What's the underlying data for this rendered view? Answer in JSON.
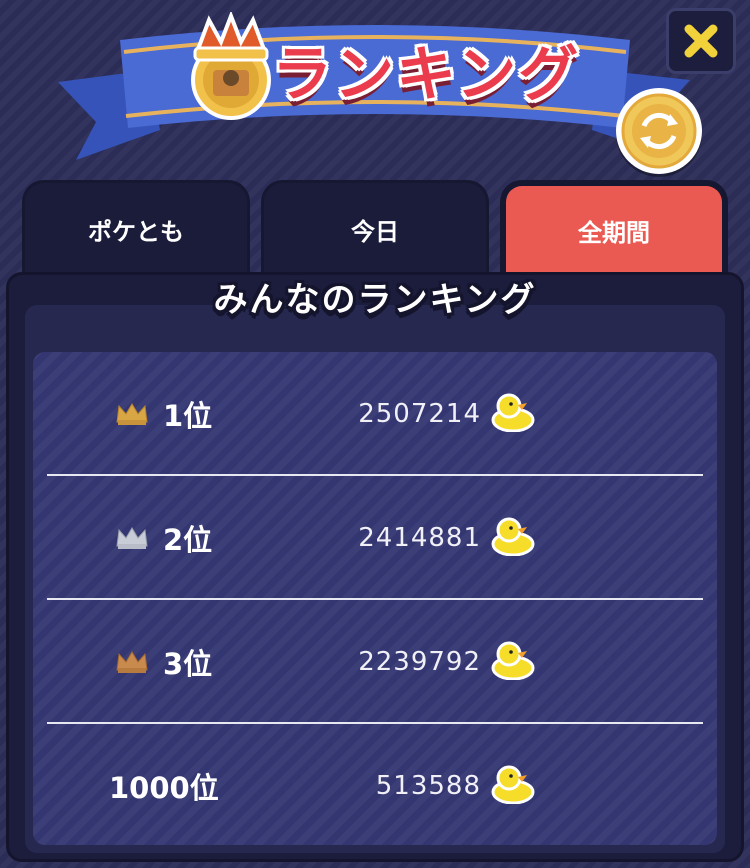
{
  "header": {
    "title": "ランキング",
    "close_icon": "close-x-icon",
    "refresh_icon": "refresh-coin-icon"
  },
  "tabs": [
    {
      "label": "ポケとも",
      "active": false
    },
    {
      "label": "今日",
      "active": false
    },
    {
      "label": "全期間",
      "active": true
    }
  ],
  "section_title": "みんなのランキング",
  "rankings": [
    {
      "rank": "1位",
      "medal": "gold",
      "score": "2507214",
      "icon": "duck-icon"
    },
    {
      "rank": "2位",
      "medal": "silver",
      "score": "2414881",
      "icon": "duck-icon"
    },
    {
      "rank": "3位",
      "medal": "bronze",
      "score": "2239792",
      "icon": "duck-icon"
    },
    {
      "rank": "1000位",
      "medal": "none",
      "score": "513588",
      "icon": "duck-icon"
    }
  ],
  "colors": {
    "active_tab": "#ea5a52",
    "title_red": "#ea3c4c",
    "ribbon_blue": "#4a6ad4",
    "gold": "#d9a645",
    "silver": "#c8ccd6",
    "bronze": "#c98a4e",
    "duck_yellow": "#f6dd2a"
  }
}
